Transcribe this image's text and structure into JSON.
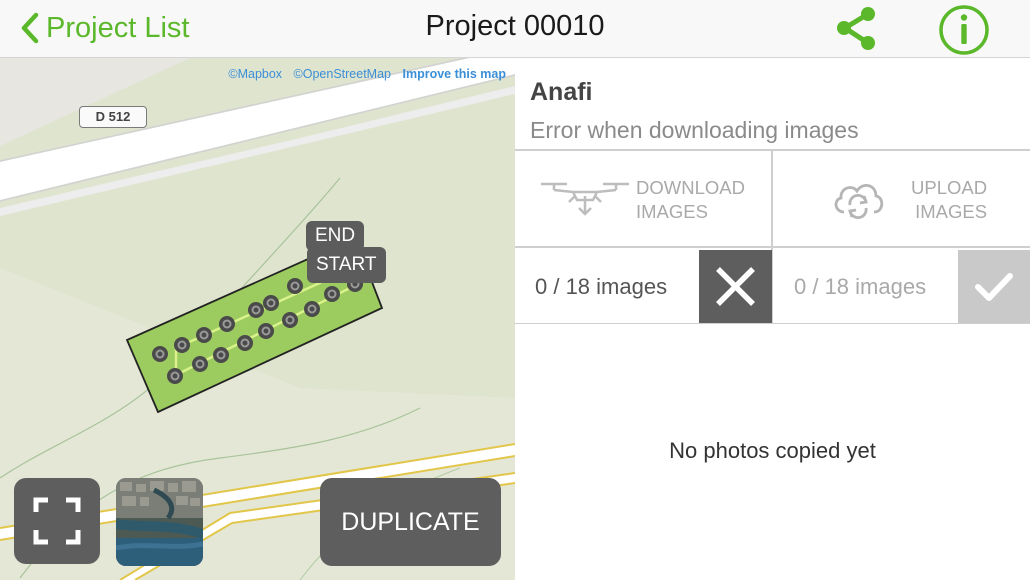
{
  "nav": {
    "back_label": "Project List",
    "title": "Project 00010",
    "accent_color": "#5cb82b"
  },
  "map": {
    "attribution": {
      "mapbox": "©Mapbox",
      "osm": "©OpenStreetMap",
      "improve": "Improve this map"
    },
    "road_label": "D 512",
    "markers": {
      "end": "END",
      "start": "START"
    },
    "buttons": {
      "duplicate": "DUPLICATE"
    }
  },
  "panel": {
    "drone_name": "Anafi",
    "status": "Error when downloading images",
    "download": {
      "line1": "DOWNLOAD",
      "line2": "IMAGES",
      "count": "0 / 18 images"
    },
    "upload": {
      "line1": "UPLOAD",
      "line2": "IMAGES",
      "count": "0 / 18 images"
    },
    "empty_message": "No photos copied yet"
  },
  "icons": {
    "back": "chevron-left-icon",
    "share": "share-icon",
    "info": "info-icon",
    "fullscreen": "fullscreen-icon",
    "satellite": "satellite-layer-icon",
    "drone": "drone-download-icon",
    "cloud": "cloud-sync-icon",
    "cancel": "close-icon",
    "confirm": "check-icon"
  }
}
